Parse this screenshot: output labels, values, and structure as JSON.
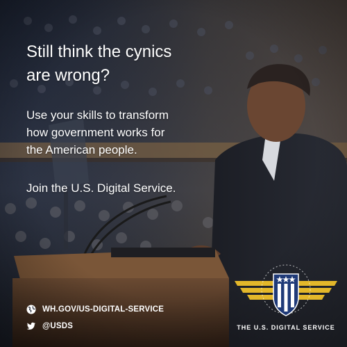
{
  "headline": {
    "line1": "Still think the cynics",
    "line2": "are wrong?"
  },
  "body": {
    "line1": "Use your skills to transform",
    "line2": "how government works for",
    "line3": "the American people."
  },
  "cta": "Join the U.S. Digital Service.",
  "contact": {
    "website": "WH.GOV/US-DIGITAL-SERVICE",
    "website_icon": "globe-icon",
    "twitter": "@USDS",
    "twitter_icon": "twitter-bird-icon"
  },
  "logo": {
    "caption": "THE U.S. DIGITAL SERVICE",
    "icon": "usds-winged-shield-logo"
  },
  "colors": {
    "text": "#ffffff",
    "wing_gold": "#e3b72a",
    "shield_navy": "#1f3a78",
    "shield_stripe": "#ffffff"
  }
}
